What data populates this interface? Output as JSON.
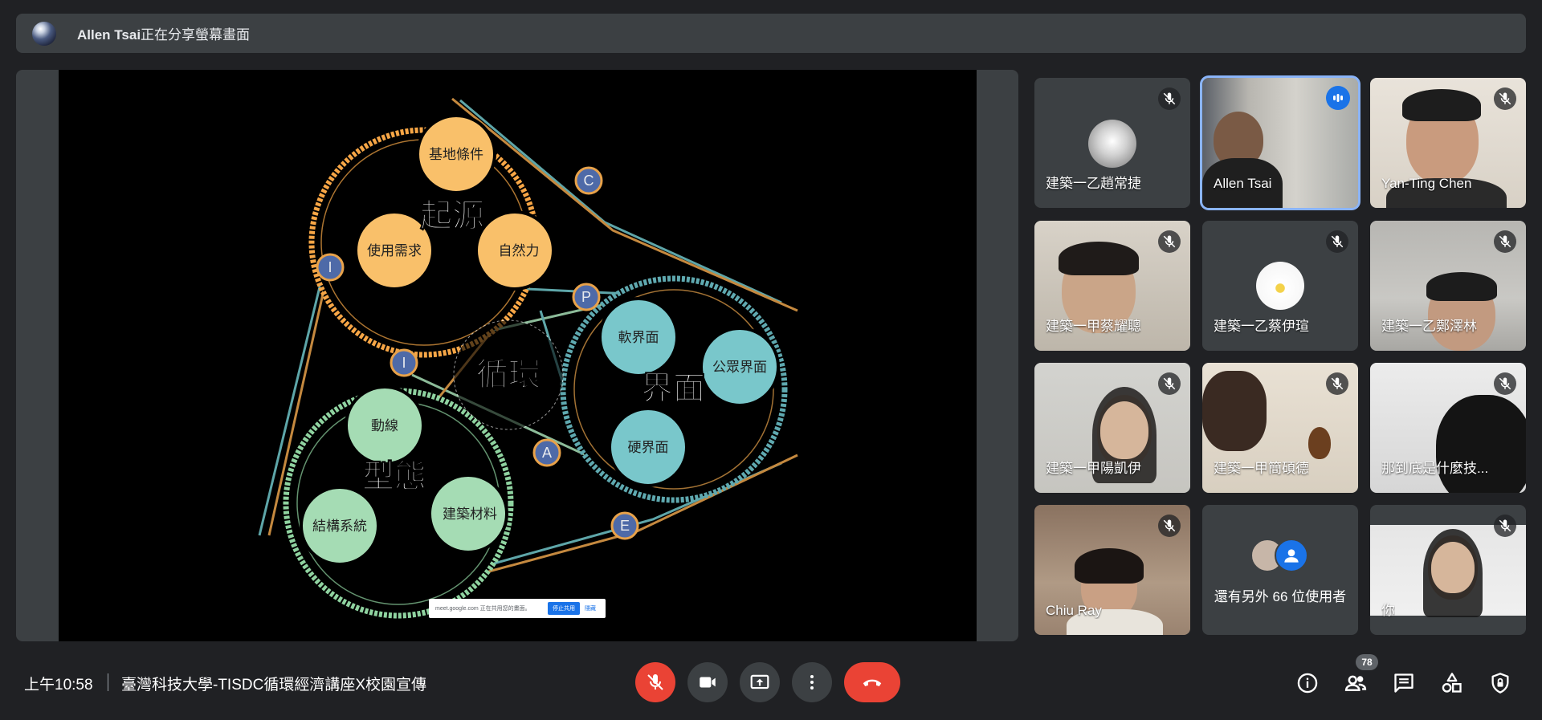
{
  "banner": {
    "presenter": "Allen Tsai",
    "message": "正在分享螢幕畫面"
  },
  "slide": {
    "center_title": "循環",
    "circles": [
      {
        "title": "起源",
        "items": [
          "基地條件",
          "使用需求",
          "自然力"
        ]
      },
      {
        "title": "界面",
        "items": [
          "軟界面",
          "公眾界面",
          "硬界面"
        ]
      },
      {
        "title": "型態",
        "items": [
          "動線",
          "結構系統",
          "建築材料"
        ]
      }
    ],
    "link_letters": [
      "C",
      "I",
      "P",
      "I",
      "A",
      "E"
    ],
    "share_bar": {
      "text": "meet.google.com 正在共用您的畫面。",
      "stop": "停止共用",
      "hide": "隱藏"
    }
  },
  "participants": [
    {
      "name": "建築一乙趙常捷",
      "muted": true
    },
    {
      "name": "Allen Tsai",
      "speaking": true
    },
    {
      "name": "Yan-Ting Chen",
      "muted": true
    },
    {
      "name": "建築一甲蔡耀聰",
      "muted": true
    },
    {
      "name": "建築一乙蔡伊瑄",
      "muted": true
    },
    {
      "name": "建築一乙鄭澤林",
      "muted": true
    },
    {
      "name": "建築一甲陽凱伊",
      "muted": true
    },
    {
      "name": "建築一甲簡碩德",
      "muted": true
    },
    {
      "name": "那到底是什麼技...",
      "muted": true
    },
    {
      "name": "Chiu Ray",
      "muted": true
    },
    {
      "name": "還有另外 66 位使用者"
    },
    {
      "name": "你",
      "muted": true
    }
  ],
  "bottom": {
    "time": "上午10:58",
    "meeting_title": "臺灣科技大學-TISDC循環經濟講座X校園宣傳",
    "participant_count": "78"
  },
  "colors": {
    "background": "#202124",
    "tile": "#3c4043",
    "danger": "#ea4335",
    "accent": "#1a73e8",
    "orange": "#f7a646",
    "teal": "#6fc3c7",
    "green": "#a5dcb4"
  }
}
